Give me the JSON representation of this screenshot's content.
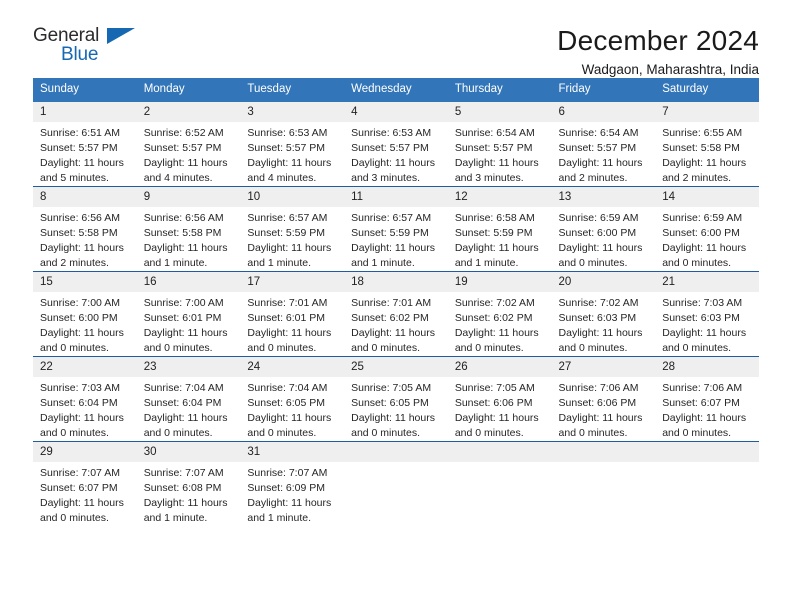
{
  "brand": {
    "name_part1": "General",
    "name_part2": "Blue",
    "accent_color": "#1668b3"
  },
  "header": {
    "title": "December 2024",
    "subtitle": "Wadgaon, Maharashtra, India"
  },
  "calendar": {
    "header_bg": "#3275b9",
    "daynum_bg": "#efefef",
    "row_divider": "#1f5d9e",
    "weekdays": [
      "Sunday",
      "Monday",
      "Tuesday",
      "Wednesday",
      "Thursday",
      "Friday",
      "Saturday"
    ],
    "weeks": [
      [
        {
          "day": "1",
          "sunrise": "Sunrise: 6:51 AM",
          "sunset": "Sunset: 5:57 PM",
          "daylight1": "Daylight: 11 hours",
          "daylight2": "and 5 minutes."
        },
        {
          "day": "2",
          "sunrise": "Sunrise: 6:52 AM",
          "sunset": "Sunset: 5:57 PM",
          "daylight1": "Daylight: 11 hours",
          "daylight2": "and 4 minutes."
        },
        {
          "day": "3",
          "sunrise": "Sunrise: 6:53 AM",
          "sunset": "Sunset: 5:57 PM",
          "daylight1": "Daylight: 11 hours",
          "daylight2": "and 4 minutes."
        },
        {
          "day": "4",
          "sunrise": "Sunrise: 6:53 AM",
          "sunset": "Sunset: 5:57 PM",
          "daylight1": "Daylight: 11 hours",
          "daylight2": "and 3 minutes."
        },
        {
          "day": "5",
          "sunrise": "Sunrise: 6:54 AM",
          "sunset": "Sunset: 5:57 PM",
          "daylight1": "Daylight: 11 hours",
          "daylight2": "and 3 minutes."
        },
        {
          "day": "6",
          "sunrise": "Sunrise: 6:54 AM",
          "sunset": "Sunset: 5:57 PM",
          "daylight1": "Daylight: 11 hours",
          "daylight2": "and 2 minutes."
        },
        {
          "day": "7",
          "sunrise": "Sunrise: 6:55 AM",
          "sunset": "Sunset: 5:58 PM",
          "daylight1": "Daylight: 11 hours",
          "daylight2": "and 2 minutes."
        }
      ],
      [
        {
          "day": "8",
          "sunrise": "Sunrise: 6:56 AM",
          "sunset": "Sunset: 5:58 PM",
          "daylight1": "Daylight: 11 hours",
          "daylight2": "and 2 minutes."
        },
        {
          "day": "9",
          "sunrise": "Sunrise: 6:56 AM",
          "sunset": "Sunset: 5:58 PM",
          "daylight1": "Daylight: 11 hours",
          "daylight2": "and 1 minute."
        },
        {
          "day": "10",
          "sunrise": "Sunrise: 6:57 AM",
          "sunset": "Sunset: 5:59 PM",
          "daylight1": "Daylight: 11 hours",
          "daylight2": "and 1 minute."
        },
        {
          "day": "11",
          "sunrise": "Sunrise: 6:57 AM",
          "sunset": "Sunset: 5:59 PM",
          "daylight1": "Daylight: 11 hours",
          "daylight2": "and 1 minute."
        },
        {
          "day": "12",
          "sunrise": "Sunrise: 6:58 AM",
          "sunset": "Sunset: 5:59 PM",
          "daylight1": "Daylight: 11 hours",
          "daylight2": "and 1 minute."
        },
        {
          "day": "13",
          "sunrise": "Sunrise: 6:59 AM",
          "sunset": "Sunset: 6:00 PM",
          "daylight1": "Daylight: 11 hours",
          "daylight2": "and 0 minutes."
        },
        {
          "day": "14",
          "sunrise": "Sunrise: 6:59 AM",
          "sunset": "Sunset: 6:00 PM",
          "daylight1": "Daylight: 11 hours",
          "daylight2": "and 0 minutes."
        }
      ],
      [
        {
          "day": "15",
          "sunrise": "Sunrise: 7:00 AM",
          "sunset": "Sunset: 6:00 PM",
          "daylight1": "Daylight: 11 hours",
          "daylight2": "and 0 minutes."
        },
        {
          "day": "16",
          "sunrise": "Sunrise: 7:00 AM",
          "sunset": "Sunset: 6:01 PM",
          "daylight1": "Daylight: 11 hours",
          "daylight2": "and 0 minutes."
        },
        {
          "day": "17",
          "sunrise": "Sunrise: 7:01 AM",
          "sunset": "Sunset: 6:01 PM",
          "daylight1": "Daylight: 11 hours",
          "daylight2": "and 0 minutes."
        },
        {
          "day": "18",
          "sunrise": "Sunrise: 7:01 AM",
          "sunset": "Sunset: 6:02 PM",
          "daylight1": "Daylight: 11 hours",
          "daylight2": "and 0 minutes."
        },
        {
          "day": "19",
          "sunrise": "Sunrise: 7:02 AM",
          "sunset": "Sunset: 6:02 PM",
          "daylight1": "Daylight: 11 hours",
          "daylight2": "and 0 minutes."
        },
        {
          "day": "20",
          "sunrise": "Sunrise: 7:02 AM",
          "sunset": "Sunset: 6:03 PM",
          "daylight1": "Daylight: 11 hours",
          "daylight2": "and 0 minutes."
        },
        {
          "day": "21",
          "sunrise": "Sunrise: 7:03 AM",
          "sunset": "Sunset: 6:03 PM",
          "daylight1": "Daylight: 11 hours",
          "daylight2": "and 0 minutes."
        }
      ],
      [
        {
          "day": "22",
          "sunrise": "Sunrise: 7:03 AM",
          "sunset": "Sunset: 6:04 PM",
          "daylight1": "Daylight: 11 hours",
          "daylight2": "and 0 minutes."
        },
        {
          "day": "23",
          "sunrise": "Sunrise: 7:04 AM",
          "sunset": "Sunset: 6:04 PM",
          "daylight1": "Daylight: 11 hours",
          "daylight2": "and 0 minutes."
        },
        {
          "day": "24",
          "sunrise": "Sunrise: 7:04 AM",
          "sunset": "Sunset: 6:05 PM",
          "daylight1": "Daylight: 11 hours",
          "daylight2": "and 0 minutes."
        },
        {
          "day": "25",
          "sunrise": "Sunrise: 7:05 AM",
          "sunset": "Sunset: 6:05 PM",
          "daylight1": "Daylight: 11 hours",
          "daylight2": "and 0 minutes."
        },
        {
          "day": "26",
          "sunrise": "Sunrise: 7:05 AM",
          "sunset": "Sunset: 6:06 PM",
          "daylight1": "Daylight: 11 hours",
          "daylight2": "and 0 minutes."
        },
        {
          "day": "27",
          "sunrise": "Sunrise: 7:06 AM",
          "sunset": "Sunset: 6:06 PM",
          "daylight1": "Daylight: 11 hours",
          "daylight2": "and 0 minutes."
        },
        {
          "day": "28",
          "sunrise": "Sunrise: 7:06 AM",
          "sunset": "Sunset: 6:07 PM",
          "daylight1": "Daylight: 11 hours",
          "daylight2": "and 0 minutes."
        }
      ],
      [
        {
          "day": "29",
          "sunrise": "Sunrise: 7:07 AM",
          "sunset": "Sunset: 6:07 PM",
          "daylight1": "Daylight: 11 hours",
          "daylight2": "and 0 minutes."
        },
        {
          "day": "30",
          "sunrise": "Sunrise: 7:07 AM",
          "sunset": "Sunset: 6:08 PM",
          "daylight1": "Daylight: 11 hours",
          "daylight2": "and 1 minute."
        },
        {
          "day": "31",
          "sunrise": "Sunrise: 7:07 AM",
          "sunset": "Sunset: 6:09 PM",
          "daylight1": "Daylight: 11 hours",
          "daylight2": "and 1 minute."
        },
        {
          "day": "",
          "sunrise": "",
          "sunset": "",
          "daylight1": "",
          "daylight2": ""
        },
        {
          "day": "",
          "sunrise": "",
          "sunset": "",
          "daylight1": "",
          "daylight2": ""
        },
        {
          "day": "",
          "sunrise": "",
          "sunset": "",
          "daylight1": "",
          "daylight2": ""
        },
        {
          "day": "",
          "sunrise": "",
          "sunset": "",
          "daylight1": "",
          "daylight2": ""
        }
      ]
    ]
  }
}
